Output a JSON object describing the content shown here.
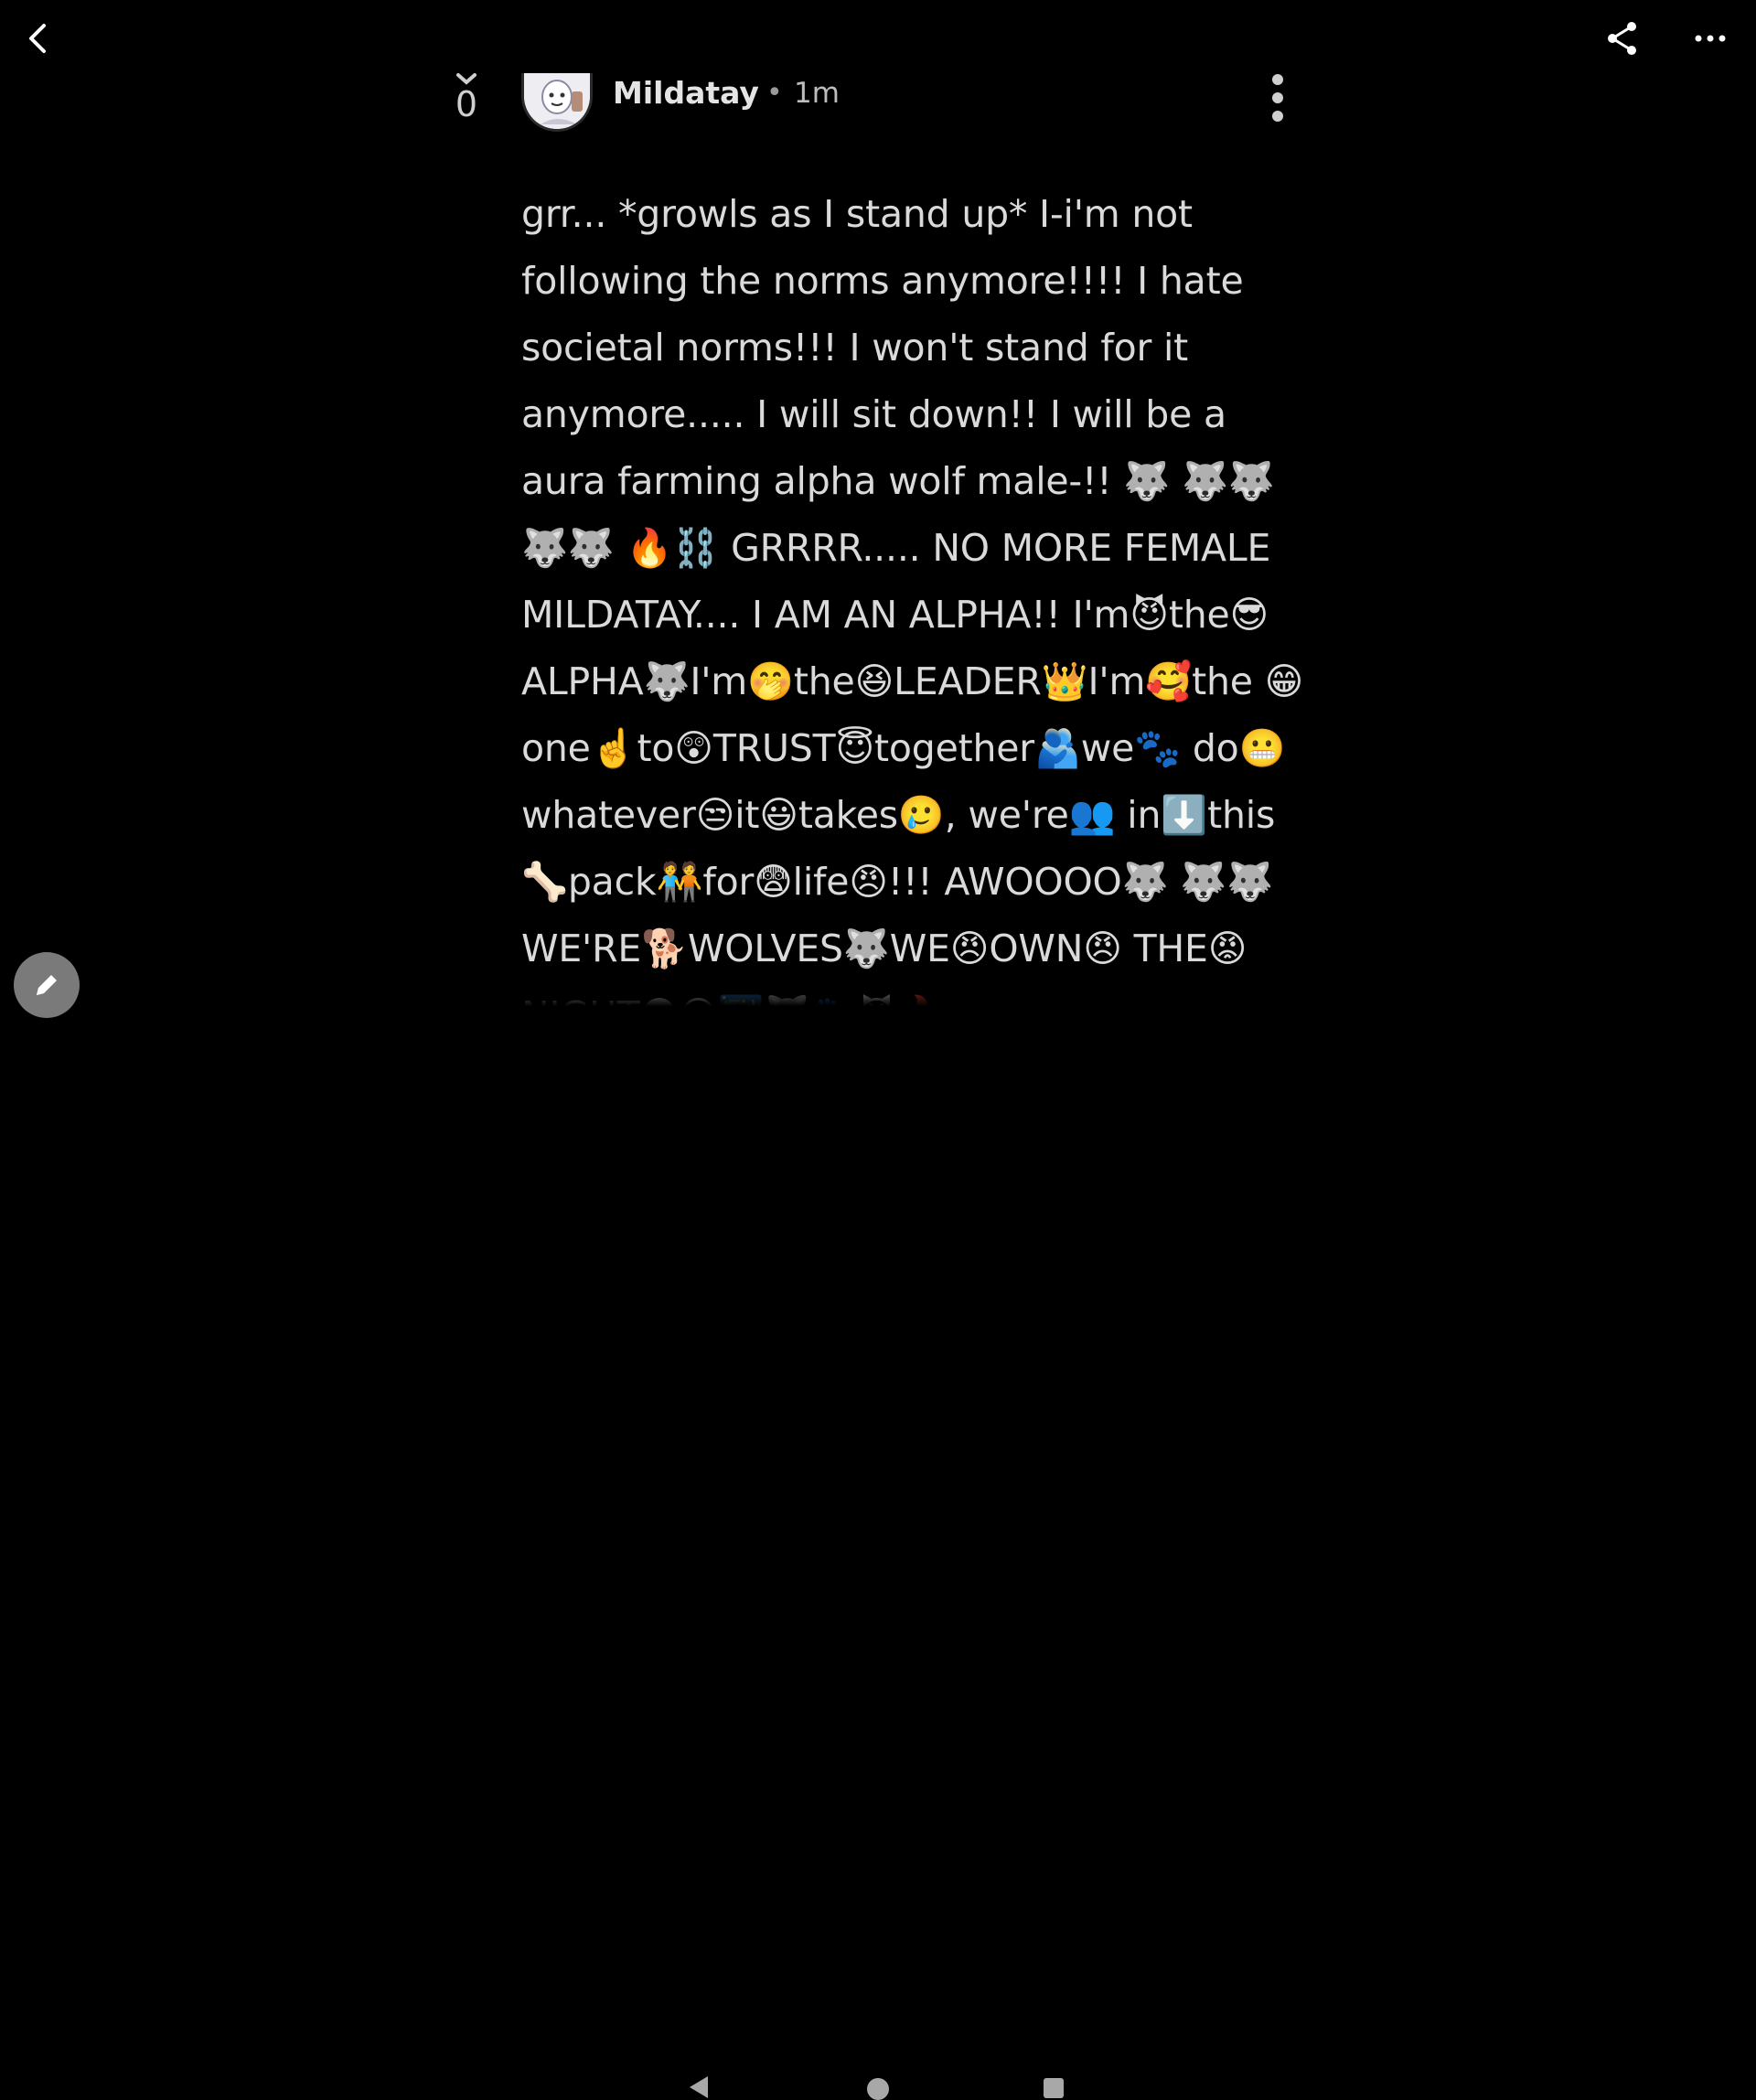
{
  "topbar": {
    "back_icon": "chevron-left-icon",
    "share_icon": "share-icon",
    "more_icon": "more-horizontal-icon"
  },
  "post": {
    "vote_count": "0",
    "username": "Mildatay",
    "separator": "•",
    "time": "1m",
    "body": "grr... *growls as I stand up* I-i'm not following the norms anymore!!!! I hate societal norms!!! I won't stand for it anymore..... I will sit down!! I will be a aura farming alpha wolf male-!! 🐺 🐺🐺🐺🐺 🔥⛓️ GRRRR..... NO MORE FEMALE MILDATAY.... I AM AN ALPHA!! I'm😈the😎 ALPHA🐺I'm🤭the😆LEADER👑I'm🥰the 😁one☝️to😲TRUST😇together🫂we🐾 do😬whatever😒it😃takes🥲, we're👥 in⬇️this🦴pack🧑‍🤝‍🧑for😨life😠!!! AWOOOO🐺 🐺🐺WE'RE🐕WOLVES🐺WE😠OWN😠 THE😡NIGHT🌑🌕🌃🐺🐾😈🔥"
  },
  "fab": {
    "icon": "pencil-icon"
  },
  "navbar": {
    "back_icon": "nav-back-triangle-icon",
    "home_icon": "nav-home-circle-icon",
    "recents_icon": "nav-recents-square-icon"
  }
}
